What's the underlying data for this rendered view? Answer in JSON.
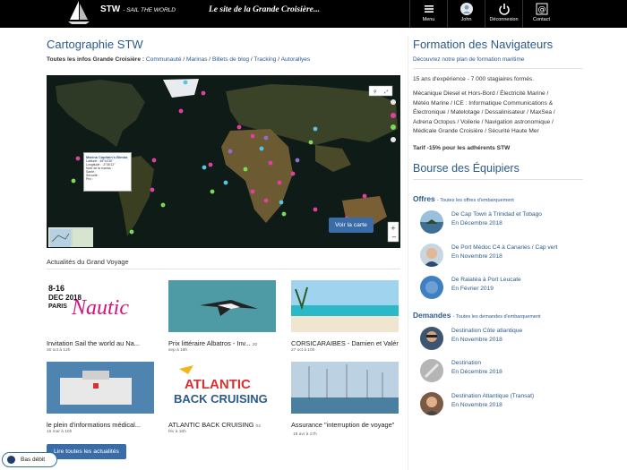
{
  "header": {
    "brand": "STW",
    "brand_sub": "- SAIL THE WORLD",
    "tagline": "Le site de la Grande Croisière...",
    "nav": [
      {
        "label": "Menu",
        "icon": "menu-icon"
      },
      {
        "label": "John",
        "icon": "user-avatar-icon"
      },
      {
        "label": "Déconnexion",
        "icon": "power-icon"
      },
      {
        "label": "Contact",
        "icon": "contact-icon"
      }
    ]
  },
  "main": {
    "title": "Cartographie STW",
    "infos_label": "Toutes les infos Grande Croisière :",
    "infos_links": [
      {
        "text": "Communauté"
      },
      {
        "text": "Marinas"
      },
      {
        "text": "Billets de blog"
      },
      {
        "text": "Tracking"
      },
      {
        "text": "Autorallyes"
      }
    ],
    "map_button": "Voir la carte",
    "map_popup": {
      "title": "Marina Capitain's Bimba",
      "l1": "Latitude :  48°44'30\"",
      "l2": "Longitude : -3°36'12\"",
      "l3": "Note de la marina :",
      "l4": "Santé :",
      "l5": "Sécurité :",
      "l6": "Prix :"
    },
    "news_heading": "Actualités du Grand Voyage",
    "news": [
      {
        "title": "Invitation Sail the world au Na...",
        "date": "30 oct à 12h"
      },
      {
        "title": "Prix littéraire Albatros - Inv...",
        "date": "sep à 18h",
        "day": "20"
      },
      {
        "title": "CORSICARAIBES - Damien et Valér...",
        "date": "27 oct à 10h"
      },
      {
        "title": "le plein d'informations médical...",
        "date": "16 mar à 10h"
      },
      {
        "title": "ATLANTIC BACK CRUISING",
        "date": "fév à 16h",
        "day": "02"
      },
      {
        "title": "Assurance \"interruption de voyage\"",
        "date": "19 avr à 17h"
      }
    ],
    "nautic_text": {
      "dates": "8-16",
      "month": "DEC 2018",
      "city": "PARIS",
      "word": "Nautic"
    },
    "atlantic_text": {
      "l1": "ATLANTIC",
      "l2": "BACK CRUISING"
    },
    "read_all": "Lire toutes les actualités",
    "low_band": "Bas débit"
  },
  "sidebar": {
    "formation_title": "Formation des Navigateurs",
    "formation_sub": "Découvrez notre plan de formation maritime",
    "formation_stats": "15 ans d'expérience - 7 000 stagiaires formés.",
    "formation_links": "Mécanique Diesel et Hors-Bord / Électricité Marine / Météo Marine / ICE : Informatique Communications & Électronique / Matelotage / Dessalinisateur / MaxSea / Adrena Octopus / Voilerie / Navigation astronomique / Médicale Grande Croisière / Sécurité Haute Mer",
    "formation_lines": [
      "Mécanique Diesel et Hors-Bord / Électricité Marine /",
      "Météo Marine / ICE : Informatique Communications &",
      "Électronique / Matelotage / Dessalinisateur / MaxSea /",
      "Adrena Octopus / Voilerie / Navigation astronomique /",
      "Médicale Grande Croisière / Sécurité Haute Mer"
    ],
    "tarif": "Tarif -15% pour les adhérents STW",
    "bourse_title": "Bourse des Équipiers",
    "offres_label": "Offres",
    "offres_sub": "- Toutes les offres d'embarquement",
    "offres": [
      {
        "route": "De Cap Town à Trinidad et Tobago",
        "when": "En Décembre 2018"
      },
      {
        "route": "De Port Médoc C4 à Canaries / Cap vert",
        "when": "En Novembre 2018"
      },
      {
        "route": "De Raiatéa à Port Leucate",
        "when": "En Février 2019"
      }
    ],
    "demandes_label": "Demandes",
    "demandes_sub": "- Toutes les demandes d'embarquement",
    "demandes": [
      {
        "route": "Destination Côte atlantique",
        "when": "En Novembre 2018"
      },
      {
        "route": "Destination",
        "when": "En Décembre 2018"
      },
      {
        "route": "Destination Atlantique (Transat)",
        "when": "En Novembre 2018"
      }
    ]
  },
  "colors": {
    "accent": "#2a5a8c",
    "button": "#3a6ca8",
    "topbar": "#000000"
  }
}
